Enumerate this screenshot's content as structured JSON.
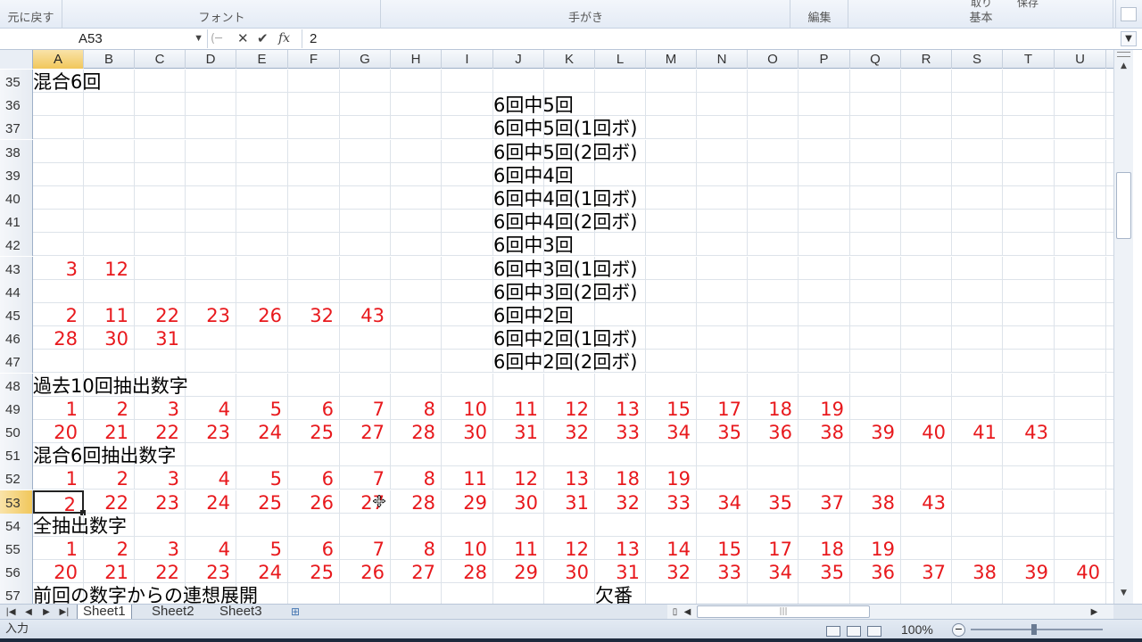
{
  "ribbon": {
    "groups": [
      {
        "label": "元に戻す"
      },
      {
        "label": "フォント"
      },
      {
        "label": "手がき"
      },
      {
        "label": "編集"
      },
      {
        "label": "基本"
      }
    ],
    "clipped_top_labels": [
      "取り",
      "保存"
    ]
  },
  "formula_bar": {
    "name_box": "A53",
    "fx_label": "fx",
    "value": "2"
  },
  "columns": [
    "A",
    "B",
    "C",
    "D",
    "E",
    "F",
    "G",
    "H",
    "I",
    "J",
    "K",
    "L",
    "M",
    "N",
    "O",
    "P",
    "Q",
    "R",
    "S",
    "T",
    "U"
  ],
  "active_cell": {
    "col": "A",
    "row": 53
  },
  "rows": [
    {
      "num": 35,
      "cells": [
        {
          "col": "A",
          "type": "text",
          "value": "混合6回"
        }
      ]
    },
    {
      "num": 36,
      "cells": [
        {
          "col": "J",
          "type": "text",
          "value": "6回中5回"
        }
      ]
    },
    {
      "num": 37,
      "cells": [
        {
          "col": "J",
          "type": "text",
          "value": "6回中5回(1回ボ)"
        }
      ]
    },
    {
      "num": 38,
      "cells": [
        {
          "col": "J",
          "type": "text",
          "value": "6回中5回(2回ボ)"
        }
      ]
    },
    {
      "num": 39,
      "cells": [
        {
          "col": "J",
          "type": "text",
          "value": "6回中4回"
        }
      ]
    },
    {
      "num": 40,
      "cells": [
        {
          "col": "J",
          "type": "text",
          "value": "6回中4回(1回ボ)"
        }
      ]
    },
    {
      "num": 41,
      "cells": [
        {
          "col": "J",
          "type": "text",
          "value": "6回中4回(2回ボ)"
        }
      ]
    },
    {
      "num": 42,
      "cells": [
        {
          "col": "J",
          "type": "text",
          "value": "6回中3回"
        }
      ]
    },
    {
      "num": 43,
      "cells": [
        {
          "col": "A",
          "type": "num",
          "value": "3"
        },
        {
          "col": "B",
          "type": "num",
          "value": "12"
        },
        {
          "col": "J",
          "type": "text",
          "value": "6回中3回(1回ボ)"
        }
      ]
    },
    {
      "num": 44,
      "cells": [
        {
          "col": "J",
          "type": "text",
          "value": "6回中3回(2回ボ)"
        }
      ]
    },
    {
      "num": 45,
      "cells": [
        {
          "col": "A",
          "type": "num",
          "value": "2"
        },
        {
          "col": "B",
          "type": "num",
          "value": "11"
        },
        {
          "col": "C",
          "type": "num",
          "value": "22"
        },
        {
          "col": "D",
          "type": "num",
          "value": "23"
        },
        {
          "col": "E",
          "type": "num",
          "value": "26"
        },
        {
          "col": "F",
          "type": "num",
          "value": "32"
        },
        {
          "col": "G",
          "type": "num",
          "value": "43"
        },
        {
          "col": "J",
          "type": "text",
          "value": "6回中2回"
        }
      ]
    },
    {
      "num": 46,
      "cells": [
        {
          "col": "A",
          "type": "num",
          "value": "28"
        },
        {
          "col": "B",
          "type": "num",
          "value": "30"
        },
        {
          "col": "C",
          "type": "num",
          "value": "31"
        },
        {
          "col": "J",
          "type": "text",
          "value": "6回中2回(1回ボ)"
        }
      ]
    },
    {
      "num": 47,
      "cells": [
        {
          "col": "J",
          "type": "text",
          "value": "6回中2回(2回ボ)"
        }
      ]
    },
    {
      "num": 48,
      "cells": [
        {
          "col": "A",
          "type": "text",
          "value": "過去10回抽出数字"
        }
      ]
    },
    {
      "num": 49,
      "cells": [
        {
          "col": "A",
          "type": "num",
          "value": "1"
        },
        {
          "col": "B",
          "type": "num",
          "value": "2"
        },
        {
          "col": "C",
          "type": "num",
          "value": "3"
        },
        {
          "col": "D",
          "type": "num",
          "value": "4"
        },
        {
          "col": "E",
          "type": "num",
          "value": "5"
        },
        {
          "col": "F",
          "type": "num",
          "value": "6"
        },
        {
          "col": "G",
          "type": "num",
          "value": "7"
        },
        {
          "col": "H",
          "type": "num",
          "value": "8"
        },
        {
          "col": "I",
          "type": "num",
          "value": "10"
        },
        {
          "col": "J",
          "type": "num",
          "value": "11"
        },
        {
          "col": "K",
          "type": "num",
          "value": "12"
        },
        {
          "col": "L",
          "type": "num",
          "value": "13"
        },
        {
          "col": "M",
          "type": "num",
          "value": "15"
        },
        {
          "col": "N",
          "type": "num",
          "value": "17"
        },
        {
          "col": "O",
          "type": "num",
          "value": "18"
        },
        {
          "col": "P",
          "type": "num",
          "value": "19"
        }
      ]
    },
    {
      "num": 50,
      "cells": [
        {
          "col": "A",
          "type": "num",
          "value": "20"
        },
        {
          "col": "B",
          "type": "num",
          "value": "21"
        },
        {
          "col": "C",
          "type": "num",
          "value": "22"
        },
        {
          "col": "D",
          "type": "num",
          "value": "23"
        },
        {
          "col": "E",
          "type": "num",
          "value": "24"
        },
        {
          "col": "F",
          "type": "num",
          "value": "25"
        },
        {
          "col": "G",
          "type": "num",
          "value": "27"
        },
        {
          "col": "H",
          "type": "num",
          "value": "28"
        },
        {
          "col": "I",
          "type": "num",
          "value": "30"
        },
        {
          "col": "J",
          "type": "num",
          "value": "31"
        },
        {
          "col": "K",
          "type": "num",
          "value": "32"
        },
        {
          "col": "L",
          "type": "num",
          "value": "33"
        },
        {
          "col": "M",
          "type": "num",
          "value": "34"
        },
        {
          "col": "N",
          "type": "num",
          "value": "35"
        },
        {
          "col": "O",
          "type": "num",
          "value": "36"
        },
        {
          "col": "P",
          "type": "num",
          "value": "38"
        },
        {
          "col": "Q",
          "type": "num",
          "value": "39"
        },
        {
          "col": "R",
          "type": "num",
          "value": "40"
        },
        {
          "col": "S",
          "type": "num",
          "value": "41"
        },
        {
          "col": "T",
          "type": "num",
          "value": "43"
        }
      ]
    },
    {
      "num": 51,
      "cells": [
        {
          "col": "A",
          "type": "text",
          "value": "混合6回抽出数字"
        }
      ]
    },
    {
      "num": 52,
      "cells": [
        {
          "col": "A",
          "type": "num",
          "value": "1"
        },
        {
          "col": "B",
          "type": "num",
          "value": "2"
        },
        {
          "col": "C",
          "type": "num",
          "value": "3"
        },
        {
          "col": "D",
          "type": "num",
          "value": "4"
        },
        {
          "col": "E",
          "type": "num",
          "value": "5"
        },
        {
          "col": "F",
          "type": "num",
          "value": "6"
        },
        {
          "col": "G",
          "type": "num",
          "value": "7"
        },
        {
          "col": "H",
          "type": "num",
          "value": "8"
        },
        {
          "col": "I",
          "type": "num",
          "value": "11"
        },
        {
          "col": "J",
          "type": "num",
          "value": "12"
        },
        {
          "col": "K",
          "type": "num",
          "value": "13"
        },
        {
          "col": "L",
          "type": "num",
          "value": "18"
        },
        {
          "col": "M",
          "type": "num",
          "value": "19"
        }
      ]
    },
    {
      "num": 53,
      "cells": [
        {
          "col": "A",
          "type": "num",
          "value": "2"
        },
        {
          "col": "B",
          "type": "num",
          "value": "22"
        },
        {
          "col": "C",
          "type": "num",
          "value": "23"
        },
        {
          "col": "D",
          "type": "num",
          "value": "24"
        },
        {
          "col": "E",
          "type": "num",
          "value": "25"
        },
        {
          "col": "F",
          "type": "num",
          "value": "26"
        },
        {
          "col": "G",
          "type": "num",
          "value": "27"
        },
        {
          "col": "H",
          "type": "num",
          "value": "28"
        },
        {
          "col": "I",
          "type": "num",
          "value": "29"
        },
        {
          "col": "J",
          "type": "num",
          "value": "30"
        },
        {
          "col": "K",
          "type": "num",
          "value": "31"
        },
        {
          "col": "L",
          "type": "num",
          "value": "32"
        },
        {
          "col": "M",
          "type": "num",
          "value": "33"
        },
        {
          "col": "N",
          "type": "num",
          "value": "34"
        },
        {
          "col": "O",
          "type": "num",
          "value": "35"
        },
        {
          "col": "P",
          "type": "num",
          "value": "37"
        },
        {
          "col": "Q",
          "type": "num",
          "value": "38"
        },
        {
          "col": "R",
          "type": "num",
          "value": "43"
        }
      ]
    },
    {
      "num": 54,
      "cells": [
        {
          "col": "A",
          "type": "text",
          "value": "全抽出数字"
        }
      ]
    },
    {
      "num": 55,
      "cells": [
        {
          "col": "A",
          "type": "num",
          "value": "1"
        },
        {
          "col": "B",
          "type": "num",
          "value": "2"
        },
        {
          "col": "C",
          "type": "num",
          "value": "3"
        },
        {
          "col": "D",
          "type": "num",
          "value": "4"
        },
        {
          "col": "E",
          "type": "num",
          "value": "5"
        },
        {
          "col": "F",
          "type": "num",
          "value": "6"
        },
        {
          "col": "G",
          "type": "num",
          "value": "7"
        },
        {
          "col": "H",
          "type": "num",
          "value": "8"
        },
        {
          "col": "I",
          "type": "num",
          "value": "10"
        },
        {
          "col": "J",
          "type": "num",
          "value": "11"
        },
        {
          "col": "K",
          "type": "num",
          "value": "12"
        },
        {
          "col": "L",
          "type": "num",
          "value": "13"
        },
        {
          "col": "M",
          "type": "num",
          "value": "14"
        },
        {
          "col": "N",
          "type": "num",
          "value": "15"
        },
        {
          "col": "O",
          "type": "num",
          "value": "17"
        },
        {
          "col": "P",
          "type": "num",
          "value": "18"
        },
        {
          "col": "Q",
          "type": "num",
          "value": "19"
        }
      ]
    },
    {
      "num": 56,
      "cells": [
        {
          "col": "A",
          "type": "num",
          "value": "20"
        },
        {
          "col": "B",
          "type": "num",
          "value": "21"
        },
        {
          "col": "C",
          "type": "num",
          "value": "22"
        },
        {
          "col": "D",
          "type": "num",
          "value": "23"
        },
        {
          "col": "E",
          "type": "num",
          "value": "24"
        },
        {
          "col": "F",
          "type": "num",
          "value": "25"
        },
        {
          "col": "G",
          "type": "num",
          "value": "26"
        },
        {
          "col": "H",
          "type": "num",
          "value": "27"
        },
        {
          "col": "I",
          "type": "num",
          "value": "28"
        },
        {
          "col": "J",
          "type": "num",
          "value": "29"
        },
        {
          "col": "K",
          "type": "num",
          "value": "30"
        },
        {
          "col": "L",
          "type": "num",
          "value": "31"
        },
        {
          "col": "M",
          "type": "num",
          "value": "32"
        },
        {
          "col": "N",
          "type": "num",
          "value": "33"
        },
        {
          "col": "O",
          "type": "num",
          "value": "34"
        },
        {
          "col": "P",
          "type": "num",
          "value": "35"
        },
        {
          "col": "Q",
          "type": "num",
          "value": "36"
        },
        {
          "col": "R",
          "type": "num",
          "value": "37"
        },
        {
          "col": "S",
          "type": "num",
          "value": "38"
        },
        {
          "col": "T",
          "type": "num",
          "value": "39"
        },
        {
          "col": "U",
          "type": "num",
          "value": "40"
        }
      ]
    },
    {
      "num": 57,
      "cells": [
        {
          "col": "A",
          "type": "text",
          "value": "前回の数字からの連想展開"
        },
        {
          "col": "L",
          "type": "text",
          "value": "欠番"
        }
      ]
    }
  ],
  "sheet_tabs": [
    {
      "label": "Sheet1",
      "active": true
    },
    {
      "label": "Sheet2",
      "active": false
    },
    {
      "label": "Sheet3",
      "active": false
    }
  ],
  "status": {
    "mode": "入力",
    "zoom": "100%"
  },
  "colors": {
    "number_red": "#e8191d",
    "header_active": "#f1c75b"
  },
  "icons": [
    "cancel-x-icon",
    "enter-check-icon",
    "function-icon",
    "dropdown-icon",
    "new-sheet-icon",
    "normal-view-icon",
    "page-layout-icon",
    "page-break-icon",
    "zoom-out-icon",
    "move-cursor-icon"
  ]
}
